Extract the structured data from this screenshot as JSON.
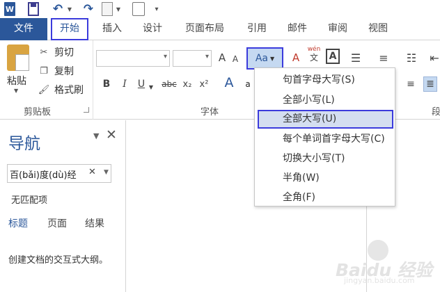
{
  "qat": {
    "app_icon": "word-icon",
    "app_letter": "W",
    "save_icon": "save-icon",
    "undo_icon": "undo-icon",
    "redo_icon": "redo-icon",
    "preview_icon": "print-preview-icon",
    "touch_icon": "touch-mode-icon"
  },
  "tabs": [
    {
      "label": "文件"
    },
    {
      "label": "开始"
    },
    {
      "label": "插入"
    },
    {
      "label": "设计"
    },
    {
      "label": "页面布局"
    },
    {
      "label": "引用"
    },
    {
      "label": "邮件"
    },
    {
      "label": "审阅"
    },
    {
      "label": "视图"
    }
  ],
  "clipboard": {
    "paste": "粘贴",
    "cut": "剪切",
    "copy": "复制",
    "format_painter": "格式刷",
    "group_label": "剪贴板"
  },
  "font": {
    "group_label": "字体",
    "grow": "A",
    "shrink": "A",
    "case_button": "Aa",
    "bold": "B",
    "italic": "I",
    "underline": "U",
    "strike": "abc",
    "subscript": "x₂",
    "superscript": "x²",
    "text_effect": "A",
    "phonetic_top": "wén",
    "phonetic_bottom": "文",
    "char_border": "A"
  },
  "paragraph": {
    "group_label_partial": "段"
  },
  "case_menu": [
    {
      "label": "句首字母大写(S)"
    },
    {
      "label": "全部小写(L)"
    },
    {
      "label": "全部大写(U)"
    },
    {
      "label": "每个单词首字母大写(C)"
    },
    {
      "label": "切换大小写(T)"
    },
    {
      "label": "半角(W)"
    },
    {
      "label": "全角(F)"
    }
  ],
  "nav": {
    "title": "导航",
    "search_value": "百(bǎi)度(dù)经",
    "no_match": "无匹配项",
    "tabs": [
      {
        "label": "标题"
      },
      {
        "label": "页面"
      },
      {
        "label": "结果"
      }
    ],
    "description": "创建文档的交互式大纲。"
  },
  "watermark": {
    "text": "Baidu 经验",
    "sub": "jingyan.baidu.com"
  }
}
